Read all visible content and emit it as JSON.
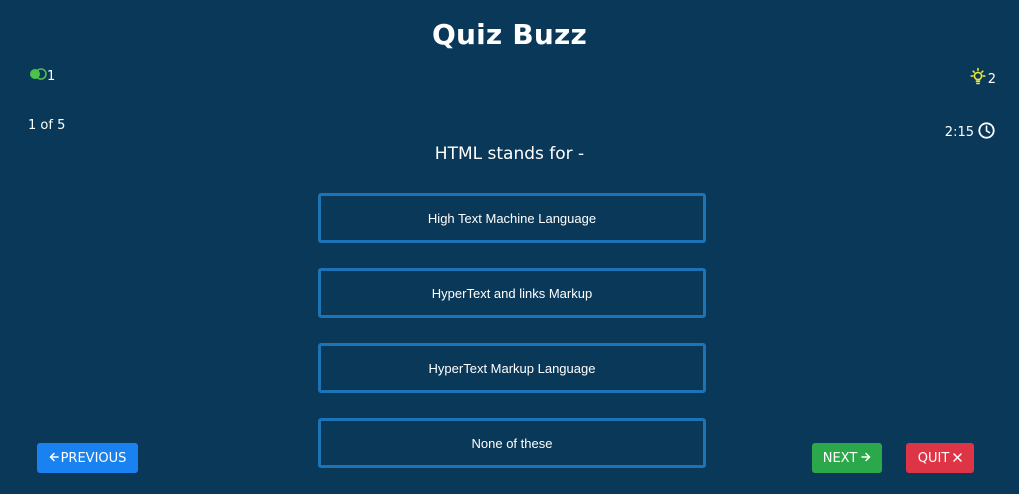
{
  "app": {
    "title": "Quiz Buzz"
  },
  "lifeline": {
    "icon": "toggle-circles-icon",
    "count": "1",
    "color": "#4cc24c"
  },
  "hints": {
    "icon": "lightbulb-icon",
    "count": "2",
    "color": "#e9e93a"
  },
  "progress": {
    "label": "1 of 5"
  },
  "timer": {
    "value": "2:15",
    "icon": "clock-icon"
  },
  "question": {
    "text": "HTML stands for -"
  },
  "options": [
    {
      "label": "High Text Machine Language"
    },
    {
      "label": "HyperText and links Markup"
    },
    {
      "label": "HyperText Markup Language"
    },
    {
      "label": "None of these"
    }
  ],
  "buttons": {
    "previous": {
      "label": "PREVIOUS",
      "color": "#1a82f0"
    },
    "next": {
      "label": "NEXT",
      "color": "#2aa84a"
    },
    "quit": {
      "label": "QUIT",
      "color": "#dd3545"
    }
  }
}
